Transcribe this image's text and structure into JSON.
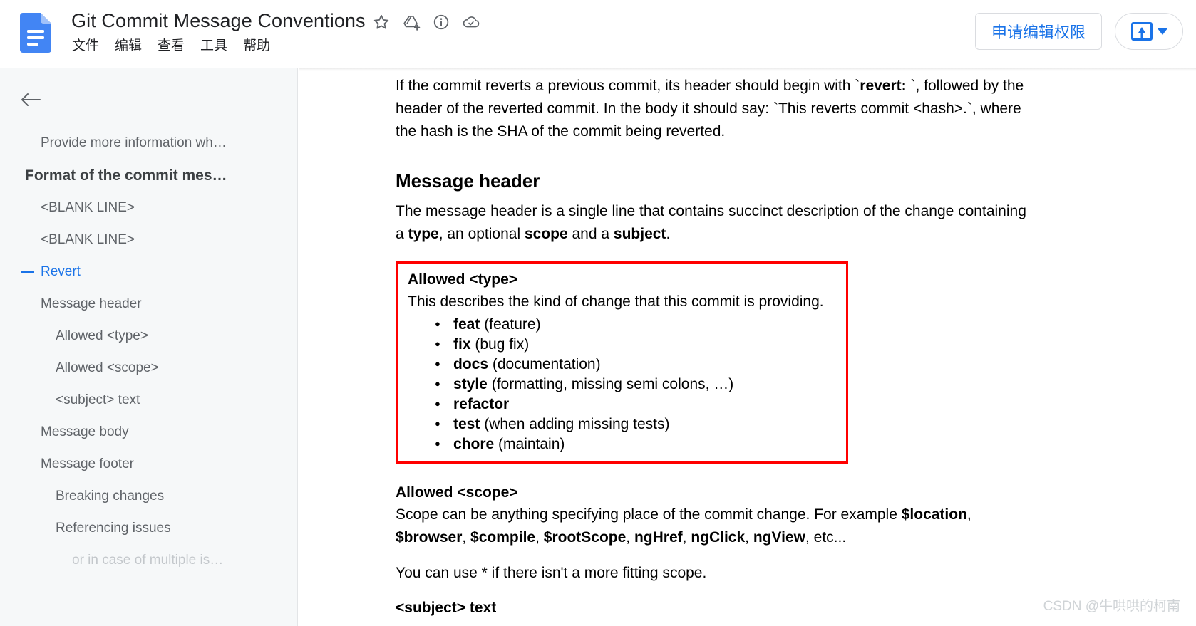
{
  "header": {
    "doc_icon": "google-docs-icon",
    "title": "Git Commit Message Conventions",
    "menu": [
      "文件",
      "编辑",
      "查看",
      "工具",
      "帮助"
    ],
    "icons": [
      "star-icon",
      "add-shortcut-to-drive-icon",
      "document-info-icon",
      "cloud-saved-icon"
    ],
    "request_access_label": "申请编辑权限",
    "share_icon": "share-upload-icon",
    "caret_icon": "chevron-down-icon"
  },
  "sidebar": {
    "back_icon": "back-arrow-icon",
    "items": [
      {
        "label": "Provide more information wh…",
        "level": 1,
        "state": "normal"
      },
      {
        "label": "Format of the commit mes…",
        "level": 0,
        "state": "normal"
      },
      {
        "label": "<BLANK LINE>",
        "level": 1,
        "state": "normal"
      },
      {
        "label": "<BLANK LINE>",
        "level": 1,
        "state": "normal"
      },
      {
        "label": "Revert",
        "level": 1,
        "state": "active"
      },
      {
        "label": "Message header",
        "level": 1,
        "state": "normal"
      },
      {
        "label": "Allowed <type>",
        "level": 2,
        "state": "normal"
      },
      {
        "label": "Allowed <scope>",
        "level": 2,
        "state": "normal"
      },
      {
        "label": "<subject> text",
        "level": 2,
        "state": "normal"
      },
      {
        "label": "Message body",
        "level": 1,
        "state": "normal"
      },
      {
        "label": "Message footer",
        "level": 1,
        "state": "normal"
      },
      {
        "label": "Breaking changes",
        "level": 2,
        "state": "normal"
      },
      {
        "label": "Referencing issues",
        "level": 2,
        "state": "normal"
      },
      {
        "label": "or in case of multiple is…",
        "level": 3,
        "state": "faded"
      }
    ]
  },
  "document": {
    "revert_paragraph_1": "If the commit reverts a previous commit, its header should begin with `",
    "revert_bold": "revert: ",
    "revert_paragraph_2": "`, followed by the header of the reverted commit. In the body it should say: `This reverts commit <hash>.`, where the hash is the SHA of the commit being reverted.",
    "message_header_heading": "Message header",
    "message_header_p1": "The message header is a single line that contains succinct description of the change containing a ",
    "message_header_b1": "type",
    "message_header_p2": ", an optional ",
    "message_header_b2": "scope",
    "message_header_p3": " and a ",
    "message_header_b3": "subject",
    "message_header_p4": ".",
    "allowed_type": {
      "heading": "Allowed <type>",
      "intro": "This describes the kind of change that this commit is providing.",
      "items": [
        {
          "name": "feat",
          "desc": " (feature)"
        },
        {
          "name": "fix",
          "desc": " (bug fix)"
        },
        {
          "name": "docs",
          "desc": " (documentation)"
        },
        {
          "name": "style",
          "desc": " (formatting, missing semi colons, …)"
        },
        {
          "name": "refactor",
          "desc": ""
        },
        {
          "name": "test",
          "desc": " (when adding missing tests)"
        },
        {
          "name": "chore",
          "desc": " (maintain)"
        }
      ],
      "border_color": "#ff0000"
    },
    "allowed_scope": {
      "heading": "Allowed <scope>",
      "p1": "Scope can be anything specifying place of the commit change. For example ",
      "b1": "$location",
      "sep1": ", ",
      "b2": "$browser",
      "sep2": ", ",
      "b3": "$compile",
      "sep3": ", ",
      "b4": "$rootScope",
      "sep4": ", ",
      "b5": "ngHref",
      "sep5": ", ",
      "b6": "ngClick",
      "sep6": ", ",
      "b7": "ngView",
      "tail": ", etc...",
      "fallback": "You can use * if there isn't a more fitting scope."
    },
    "subject_heading": "<subject> text"
  },
  "watermark": "CSDN @牛哄哄的柯南"
}
